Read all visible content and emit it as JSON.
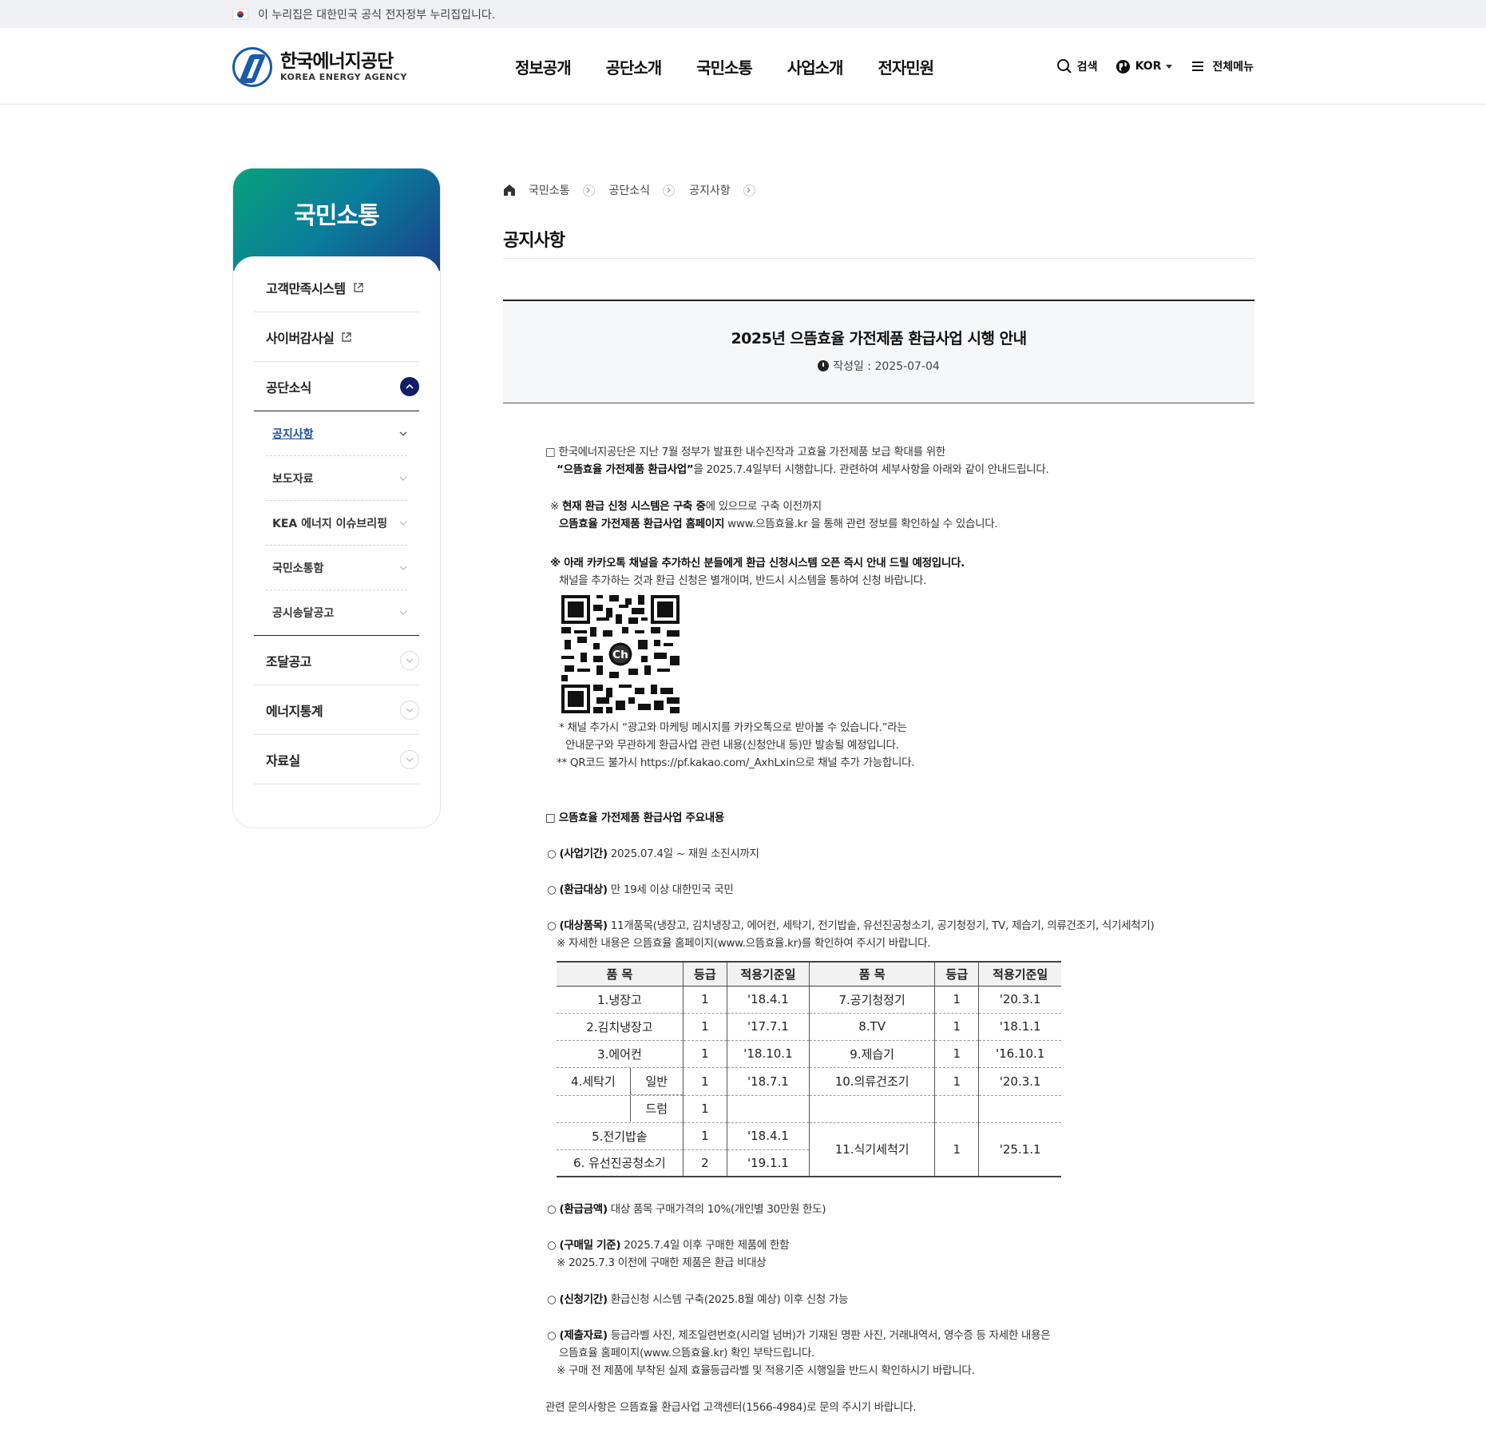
{
  "gov_bar": {
    "text": "이 누리집은 대한민국 공식 전자정부 누리집입니다."
  },
  "header": {
    "logo_ko": "한국에너지공단",
    "logo_en": "KOREA ENERGY AGENCY",
    "gnb": [
      "정보공개",
      "공단소개",
      "국민소통",
      "사업소개",
      "전자민원"
    ],
    "search_label": "검색",
    "lang_label": "KOR",
    "allmenu_label": "전체메뉴"
  },
  "sidebar": {
    "title": "국민소통",
    "items": [
      {
        "label": "고객만족시스템"
      },
      {
        "label": "사이버감사실"
      },
      {
        "label": "공단소식"
      },
      {
        "label": "조달공고"
      },
      {
        "label": "에너지통계"
      },
      {
        "label": "자료실"
      }
    ],
    "sub_items": [
      {
        "label": "공지사항"
      },
      {
        "label": "보도자료"
      },
      {
        "label": "KEA 에너지 이슈브리핑"
      },
      {
        "label": "국민소통함"
      },
      {
        "label": "공시송달공고"
      }
    ]
  },
  "breadcrumb": [
    "국민소통",
    "공단소식",
    "공지사항"
  ],
  "page_title": "공지사항",
  "post": {
    "title": "2025년 으뜸효율 가전제품 환급사업 시행 안내",
    "date": "작성일 : 2025-07-04"
  },
  "content": {
    "p1_l1": "□ 한국에너지공단은 지난 7월 정부가 발표한 내수진작과 고효율 가전제품 보급 확대를 위한",
    "p1_l2_b": "“으뜸효율 가전제품 환급사업”",
    "p1_l2": "을 2025.7.4일부터 시행합니다. 관련하여 세부사항을 아래와 같이 안내드립니다.",
    "n1_pre": "※ ",
    "n1_b": "현재 환급 신청 시스템은 구축 중",
    "n1": "에 있으므로 구축 이전까지",
    "n1_l2_b": "으뜸효율 가전제품 환급사업 홈페이지",
    "n1_l2": " www.으뜸효율.kr 을 통해 관련 정보를 확인하실 수 있습니다.",
    "n2_b": "※ 아래 카카오톡 채널을 추가하신 분들에게 환급 신청시스템 오픈 즉시 안내 드릴 예정입니다.",
    "n2_l2": "채널을 추가하는 것과 환급 신청은 별개이며, 반드시 시스템을 통하여 신청 바랍니다.",
    "qr_ch": "Ch",
    "q1": "* 채널 추가시 “광고와 마케팅 메시지를 카카오톡으로 받아볼 수 있습니다.”라는",
    "q2": "안내문구와 무관하게 환급사업 관련 내용(신청안내 등)만 발송될 예정입니다.",
    "q3": "** QR코드 불가시 https://pf.kakao.com/_AxhLxin으로 채널 추가 가능합니다.",
    "sec2": "□ 으뜸효율 가전제품 환급사업 주요내용",
    "b1_k": "(사업기간)",
    "b1": " 2025.07.4일 ~ 재원 소진시까지",
    "b2_k": "(환급대상)",
    "b2": " 만 19세 이상 대한민국 국민",
    "b3_k": "(대상품목)",
    "b3": " 11개품목(냉장고, 김치냉장고, 에어컨, 세탁기, 전기밥솥, 유선진공청소기, 공기청정기, TV, 제습기, 의류건조기, 식기세척기)",
    "b3_l2": "※ 자세한 내용은 으뜸효율 홈페이지(www.으뜸효율.kr)를 확인하여 주시기 바랍니다.",
    "b4_k": "(환급금액)",
    "b4": " 대상 품목 구매가격의 10%(개인별 30만원 한도)",
    "b5_k": "(구매일 기준)",
    "b5": " 2025.7.4일 이후 구매한 제품에 한함",
    "b5_l2": "※ 2025.7.3 이전에 구매한 제품은 환급 비대상",
    "b6_k": "(신청기간)",
    "b6": " 환급신청 시스템 구축(2025.8월 예상) 이후 신청 가능",
    "b7_k": "(제출자료)",
    "b7": " 등급라벨 사진, 제조일련번호(시리얼 넘버)가 기재된 명판 사진, 거래내역서, 영수증 등 자세한 내용은",
    "b7_l2": "으뜸효율 홈페이지(www.으뜸효율.kr) 확인 부탁드립니다.",
    "b7_l3": "※ 구매 전 제품에 부착된 실제 효율등급라벨 및 적용기준 시행일을 반드시 확인하시기 바랍니다.",
    "footer": "관련 문의사항은 으뜸효율 환급사업 고객센터(1566-4984)로 문의 주시기 바랍니다."
  },
  "table": {
    "headers": [
      "품 목",
      "등급",
      "적용기준일",
      "품 목",
      "등급",
      "적용기준일"
    ],
    "r1": [
      "1.냉장고",
      "1",
      "'18.4.1",
      "7.공기청정기",
      "1",
      "'20.3.1"
    ],
    "r2": [
      "2.김치냉장고",
      "1",
      "'17.7.1",
      "8.TV",
      "1",
      "'18.1.1"
    ],
    "r3": [
      "3.에어컨",
      "1",
      "'18.10.1",
      "9.제습기",
      "1",
      "'16.10.1"
    ],
    "r4": [
      "4.세탁기",
      "일반",
      "1",
      "'18.7.1",
      "10.의류건조기",
      "1",
      "'20.3.1"
    ],
    "r5": [
      "드럼",
      "1"
    ],
    "r6": [
      "5.전기밥솥",
      "1",
      "'18.4.1",
      "11.식기세척기",
      "1",
      "'25.1.1"
    ],
    "r7": [
      "6.  유선진공청소기",
      "2",
      "'19.1.1"
    ]
  },
  "colors": {
    "brand_blue": "#1a5aa8",
    "navy": "#0e1f66",
    "sidebar_green": "#08a17a"
  }
}
